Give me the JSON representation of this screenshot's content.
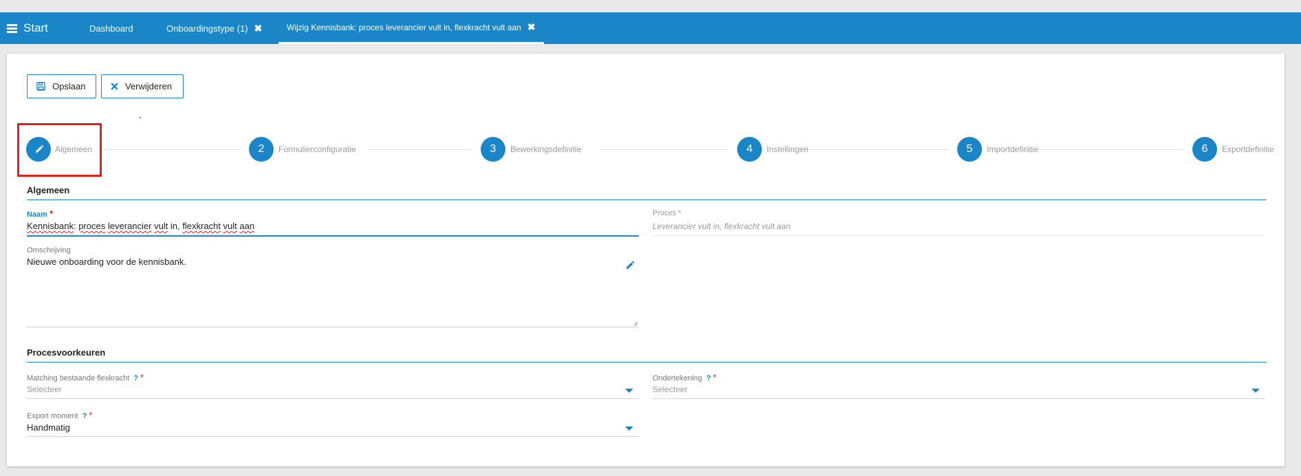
{
  "topbar": {
    "start_label": "Start",
    "tabs": [
      {
        "label": "Dashboard",
        "closable": false
      },
      {
        "label": "Onboardingstype (1)",
        "closable": true
      },
      {
        "label": "Wijzig Kennisbank: proces leverancier vult in, flexkracht vult aan",
        "closable": true,
        "active": true
      }
    ],
    "close_glyph": "✖"
  },
  "toolbar": {
    "save_label": "Opslaan",
    "delete_label": "Verwijderen",
    "save_icon": "floppy-disk-icon",
    "delete_icon": "close-icon"
  },
  "stepper": {
    "steps": [
      {
        "num": "",
        "label": "Algemeen",
        "icon": "pencil-icon",
        "active": true
      },
      {
        "num": "2",
        "label": "Formulierconfiguratie"
      },
      {
        "num": "3",
        "label": "Bewerkingsdefinitie"
      },
      {
        "num": "4",
        "label": "Instellingen"
      },
      {
        "num": "5",
        "label": "Importdefinitie"
      },
      {
        "num": "6",
        "label": "Exportdefinitie"
      }
    ]
  },
  "general": {
    "title": "Algemeen",
    "naam_label": "Naam",
    "naam_parts": [
      "Kennisbank",
      ": ",
      "proces",
      " ",
      "leverancier",
      " ",
      "vult",
      " in, ",
      "flexkracht",
      " ",
      "vult",
      " ",
      "aan"
    ],
    "proces_label": "Proces *",
    "proces_value": "Leverancier vult in, flexkracht vult aan",
    "omschrijving_label": "Omschrijving",
    "omschrijving_value": "Nieuwe onboarding voor de kennisbank."
  },
  "preferences": {
    "title": "Procesvoorkeuren",
    "matching_label": "Matching bestaande flexkracht",
    "matching_value": "Selecteer",
    "ondertekening_label": "Ondertekening",
    "ondertekening_value": "Selecteer",
    "export_label": "Export moment",
    "export_value": "Handmatig"
  },
  "glyphs": {
    "required": "*",
    "help": "?"
  },
  "colors": {
    "accent": "#1a86c7",
    "required": "#e02020",
    "highlight": "#e02020"
  }
}
